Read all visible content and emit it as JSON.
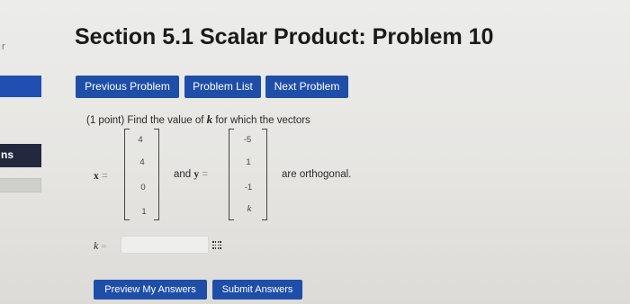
{
  "sidebar": {
    "letter": "r",
    "item_label": "ns"
  },
  "header": {
    "title": "Section 5.1 Scalar Product: Problem 10"
  },
  "nav": {
    "previous": "Previous Problem",
    "list": "Problem List",
    "next": "Next Problem"
  },
  "problem": {
    "points": "(1 point)",
    "intro": "Find the value of",
    "variable": "k",
    "intro_end": "for which the vectors",
    "x_label": "x",
    "equals": "=",
    "and_text": "and",
    "y_label": "y",
    "orthogonal_text": "are orthogonal.",
    "x_vector": [
      "4",
      "4",
      "0",
      "1"
    ],
    "y_vector": [
      "-5",
      "1",
      "-1",
      "k"
    ]
  },
  "answer": {
    "label": "k",
    "equals": "=",
    "value": "",
    "placeholder": ""
  },
  "actions": {
    "preview": "Preview My Answers",
    "submit": "Submit Answers"
  },
  "colors": {
    "button": "#1e4ea8",
    "sidebar_blue": "#1f4fb3",
    "sidebar_dark": "#22283d",
    "background": "#e6e5e2"
  }
}
